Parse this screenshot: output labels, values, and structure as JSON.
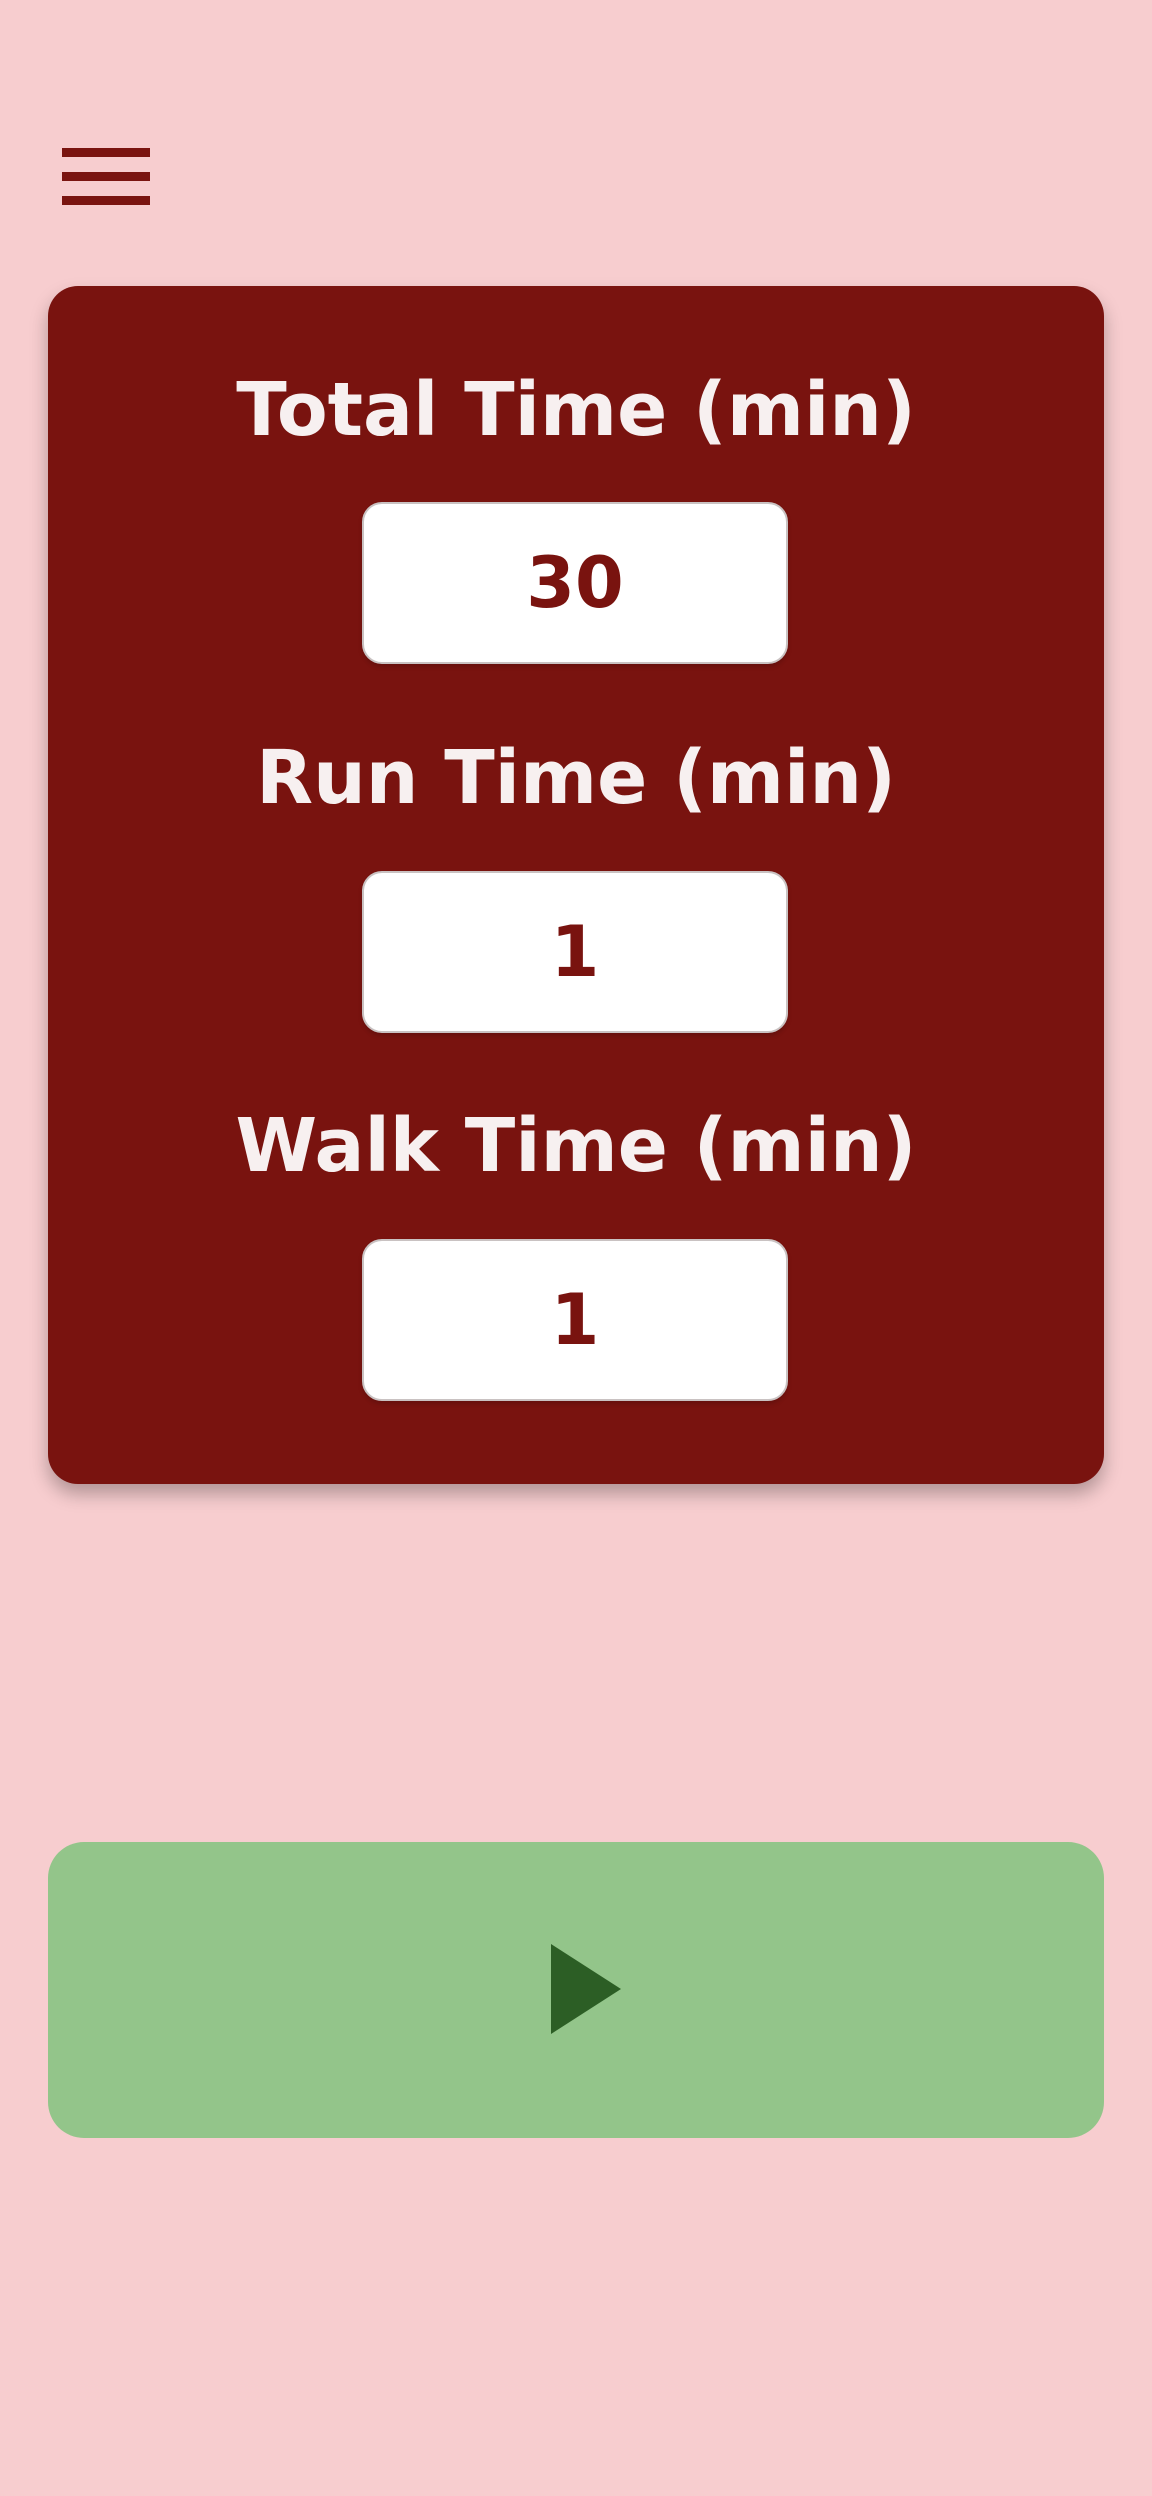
{
  "colors": {
    "background": "#f7cdcf",
    "card": "#79130f",
    "label_text": "#f7f0f0",
    "input_text": "#79130f",
    "start_button": "#93c58a",
    "play_icon": "#2c5e25",
    "menu_icon": "#7a1410"
  },
  "menu": {
    "icon": "hamburger-menu-icon"
  },
  "fields": {
    "total": {
      "label": "Total Time (min)",
      "value": "30"
    },
    "run": {
      "label": "Run Time (min)",
      "value": "1"
    },
    "walk": {
      "label": "Walk Time (min)",
      "value": "1"
    }
  },
  "start_button": {
    "icon": "play-icon"
  }
}
